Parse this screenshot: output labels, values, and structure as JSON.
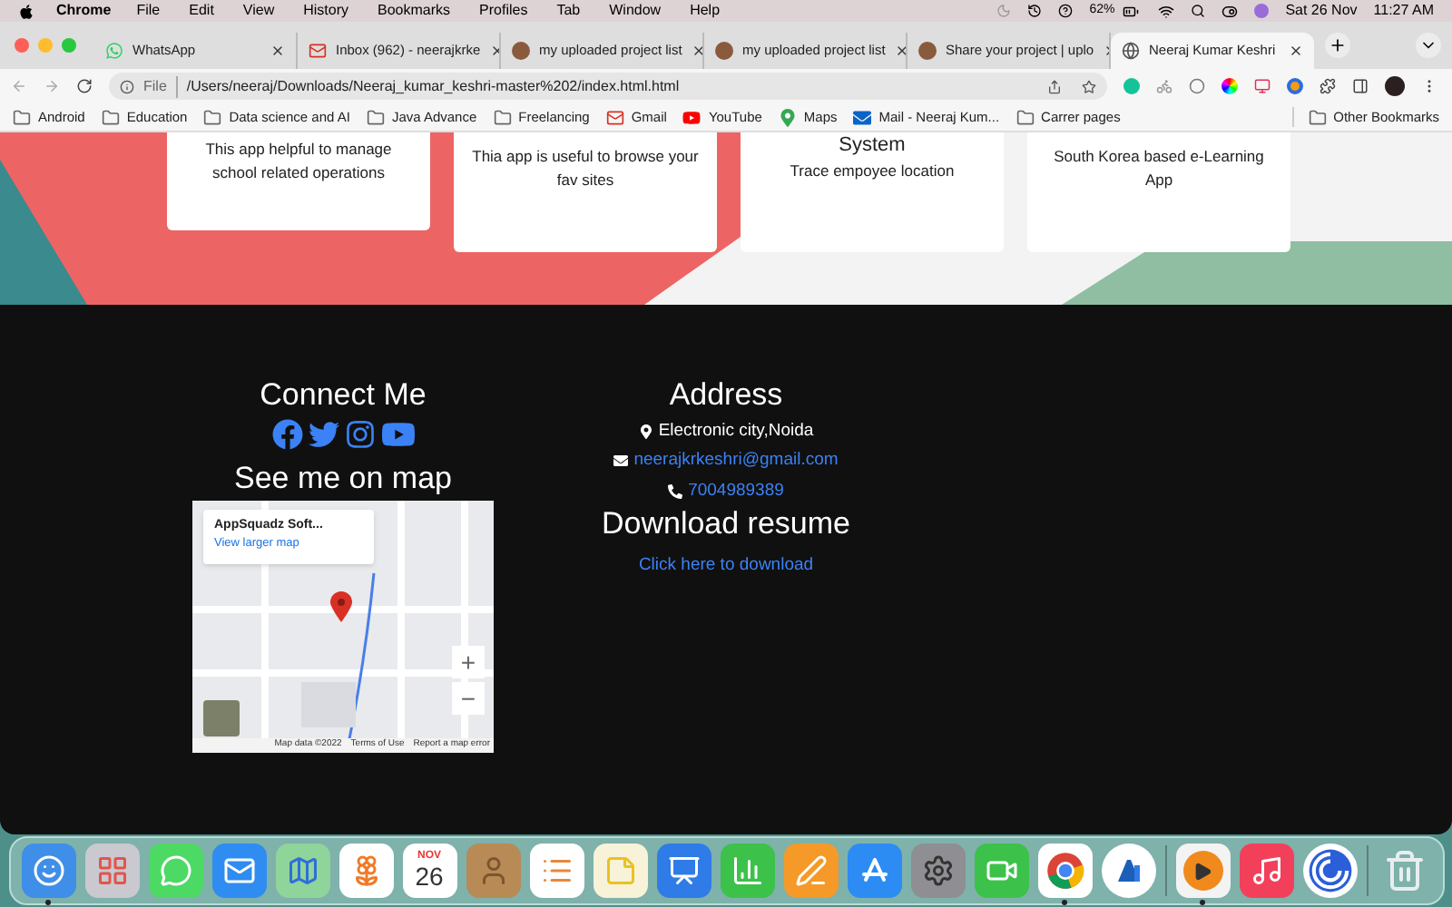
{
  "menu_bar": {
    "app": "Chrome",
    "menus": [
      "File",
      "Edit",
      "View",
      "History",
      "Bookmarks",
      "Profiles",
      "Tab",
      "Window",
      "Help"
    ],
    "battery": "62%",
    "date": "Sat 26 Nov",
    "time": "11:27 AM"
  },
  "tabs": [
    {
      "title": "WhatsApp",
      "kind": "whatsapp",
      "selected": false
    },
    {
      "title": "Inbox (962) - neerajkrke",
      "kind": "gmail",
      "selected": false
    },
    {
      "title": "my uploaded project list",
      "kind": "avatar",
      "selected": false
    },
    {
      "title": "my uploaded project list",
      "kind": "avatar",
      "selected": false
    },
    {
      "title": "Share your project | uplo",
      "kind": "avatar",
      "selected": false
    },
    {
      "title": "Neeraj Kumar Keshri",
      "kind": "globe",
      "selected": true
    }
  ],
  "address_bar": {
    "scheme": "File",
    "url": "/Users/neeraj/Downloads/Neeraj_kumar_keshri-master%202/index.html.html"
  },
  "bookmarks": [
    {
      "label": "Android",
      "kind": "folder"
    },
    {
      "label": "Education",
      "kind": "folder"
    },
    {
      "label": "Data science and AI",
      "kind": "folder"
    },
    {
      "label": "Java Advance",
      "kind": "folder"
    },
    {
      "label": "Freelancing",
      "kind": "folder"
    },
    {
      "label": "Gmail",
      "kind": "gmail"
    },
    {
      "label": "YouTube",
      "kind": "youtube"
    },
    {
      "label": "Maps",
      "kind": "maps"
    },
    {
      "label": "Mail - Neeraj Kum...",
      "kind": "mail"
    },
    {
      "label": "Carrer pages",
      "kind": "folder"
    }
  ],
  "other_bookmarks": "Other Bookmarks",
  "cards": [
    {
      "text": "This app helpful to manage school related operations"
    },
    {
      "text": "Thia app is useful to browse your fav sites"
    },
    {
      "heading": "System",
      "text": "Trace empoyee location"
    },
    {
      "text": "South Korea based e-Learning App"
    }
  ],
  "footer": {
    "connect_title": "Connect Me",
    "map_title": "See me on map",
    "map": {
      "place": "AppSquadz Soft...",
      "link": "View larger map",
      "zoom_in": "+",
      "zoom_out": "−",
      "attribution": "Map data ©2022",
      "terms": "Terms of Use",
      "report": "Report a map error"
    },
    "address_title": "Address",
    "location": "Electronic city,Noida",
    "email": "neerajkrkeshri@gmail.com",
    "phone": "7004989389",
    "resume_title": "Download resume",
    "resume_link": "Click here to download"
  },
  "dock": [
    {
      "kind": "finder",
      "running": true
    },
    {
      "kind": "launchpad",
      "running": false
    },
    {
      "kind": "messages",
      "running": false
    },
    {
      "kind": "mail",
      "running": false
    },
    {
      "kind": "maps",
      "running": false
    },
    {
      "kind": "photos",
      "running": false
    },
    {
      "kind": "calendar",
      "running": false,
      "month": "NOV",
      "day": "26"
    },
    {
      "kind": "contacts",
      "running": false
    },
    {
      "kind": "reminders",
      "running": false
    },
    {
      "kind": "notes",
      "running": false
    },
    {
      "kind": "keynote",
      "running": false
    },
    {
      "kind": "numbers",
      "running": false
    },
    {
      "kind": "pages",
      "running": false
    },
    {
      "kind": "appstore",
      "running": false
    },
    {
      "kind": "settings",
      "running": false
    },
    {
      "kind": "facetime",
      "running": false
    },
    {
      "kind": "chrome",
      "running": true
    },
    {
      "kind": "studio",
      "running": false
    },
    {
      "kind": "separator"
    },
    {
      "kind": "player",
      "running": true
    },
    {
      "kind": "music",
      "running": false
    },
    {
      "kind": "spiral",
      "running": false
    },
    {
      "kind": "separator"
    },
    {
      "kind": "trash",
      "running": false
    }
  ]
}
